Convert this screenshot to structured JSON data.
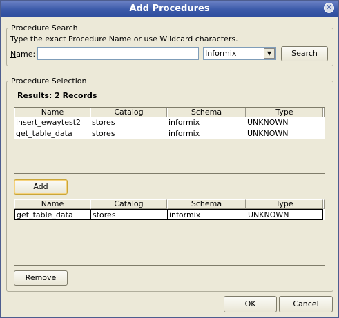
{
  "window": {
    "title": "Add Procedures"
  },
  "search": {
    "legend": "Procedure Search",
    "instruction": "Type the exact Procedure Name or use Wildcard characters.",
    "name_label": "Name:",
    "name_value": "",
    "database_type": "Informix",
    "search_button": "Search"
  },
  "selection": {
    "legend": "Procedure Selection",
    "results_text": "Results:  2 Records",
    "columns": [
      "Name",
      "Catalog",
      "Schema",
      "Type"
    ],
    "results_rows": [
      [
        "insert_ewaytest2",
        "stores",
        "informix",
        "UNKNOWN"
      ],
      [
        "get_table_data",
        "stores",
        "informix",
        "UNKNOWN"
      ]
    ],
    "add_button": "Add",
    "selected_rows": [
      [
        "get_table_data",
        "stores",
        "informix",
        "UNKNOWN"
      ]
    ],
    "remove_button": "Remove"
  },
  "footer": {
    "ok_button": "OK",
    "cancel_button": "Cancel"
  }
}
